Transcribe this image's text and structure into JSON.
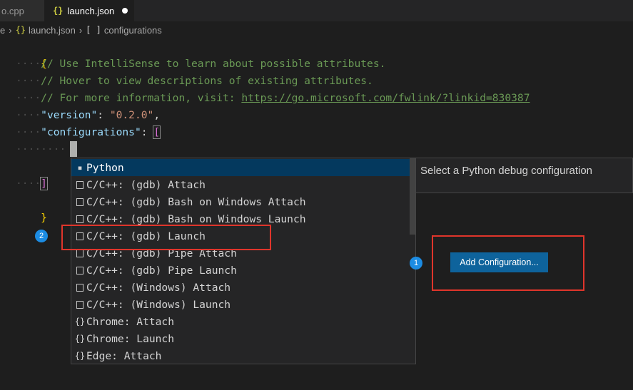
{
  "tabs": [
    {
      "label": "o.cpp",
      "active": false
    },
    {
      "label": "launch.json",
      "active": true,
      "icon": "{}",
      "dirty": true
    }
  ],
  "breadcrumb": {
    "root": "e",
    "file": "launch.json",
    "file_icon": "{}",
    "symbol": "configurations",
    "symbol_icon": "[ ]"
  },
  "code": {
    "open_brace": "{",
    "comment1": "// Use IntelliSense to learn about possible attributes.",
    "comment2": "// Hover to view descriptions of existing attributes.",
    "comment3_prefix": "// For more information, visit: ",
    "comment3_link": "https://go.microsoft.com/fwlink/?linkid=830387",
    "version_key": "\"version\"",
    "version_value": "\"0.2.0\"",
    "configurations_key": "\"configurations\"",
    "open_bracket": "[",
    "close_bracket": "]",
    "close_brace": "}",
    "colon": ": ",
    "comma": ","
  },
  "suggest": {
    "items": [
      {
        "label": "Python",
        "icon": "snippet-icon",
        "selected": true
      },
      {
        "label": "C/C++: (gdb) Attach",
        "icon": "box-icon"
      },
      {
        "label": "C/C++: (gdb) Bash on Windows Attach",
        "icon": "box-icon"
      },
      {
        "label": "C/C++: (gdb) Bash on Windows Launch",
        "icon": "box-icon"
      },
      {
        "label": "C/C++: (gdb) Launch",
        "icon": "box-icon"
      },
      {
        "label": "C/C++: (gdb) Pipe Attach",
        "icon": "box-icon"
      },
      {
        "label": "C/C++: (gdb) Pipe Launch",
        "icon": "box-icon"
      },
      {
        "label": "C/C++: (Windows) Attach",
        "icon": "box-icon"
      },
      {
        "label": "C/C++: (Windows) Launch",
        "icon": "box-icon"
      },
      {
        "label": "Chrome: Attach",
        "icon": "braces-icon"
      },
      {
        "label": "Chrome: Launch",
        "icon": "braces-icon"
      },
      {
        "label": "Edge: Attach",
        "icon": "braces-icon"
      }
    ],
    "details": "Select a Python debug configuration"
  },
  "annotations": {
    "badge1": "1",
    "badge2": "2",
    "highlight_color": "#e0352b",
    "badge_color": "#1c8ce3"
  },
  "add_config_button": "Add Configuration..."
}
